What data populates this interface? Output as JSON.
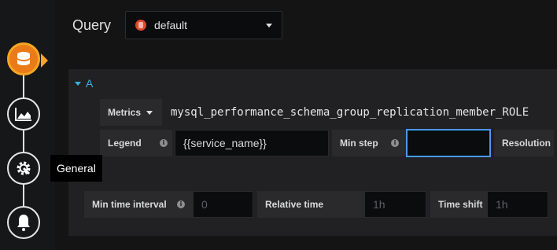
{
  "tooltip": {
    "text": "General"
  },
  "query": {
    "label": "Query",
    "datasource": "default"
  },
  "query_a": {
    "ref": "A",
    "metrics_label": "Metrics",
    "metrics_value": "mysql_performance_schema_group_replication_member_ROLE",
    "legend_label": "Legend",
    "legend_value": "{{service_name}}",
    "min_step_label": "Min step",
    "min_step_value": "",
    "resolution_label": "Resolution"
  },
  "options": {
    "min_interval_label": "Min time interval",
    "min_interval_placeholder": "0",
    "relative_time_label": "Relative time",
    "relative_time_placeholder": "1h",
    "time_shift_label": "Time shift",
    "time_shift_placeholder": "1h"
  },
  "colors": {
    "accent": "#33b5e5",
    "active_tab": "#eb7b18",
    "focus": "#5794f2"
  }
}
